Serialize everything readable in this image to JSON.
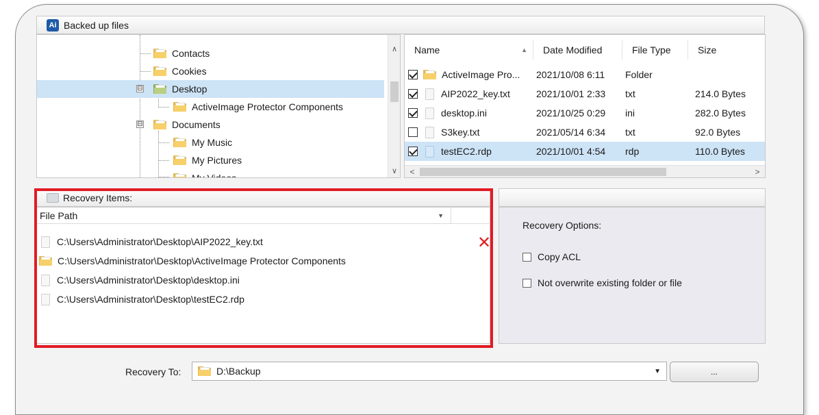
{
  "backed_up": {
    "title": "Backed up files",
    "app_icon_text": "Ai"
  },
  "tree": {
    "items": [
      {
        "label": "Contacts"
      },
      {
        "label": "Cookies"
      },
      {
        "label": "Desktop",
        "expander": "⊟"
      },
      {
        "label": "ActiveImage Protector Components"
      },
      {
        "label": "Documents",
        "expander": "⊟"
      },
      {
        "label": "My Music"
      },
      {
        "label": "My Pictures"
      },
      {
        "label": "My Videos"
      }
    ]
  },
  "file_list": {
    "columns": {
      "name": "Name",
      "date": "Date Modified",
      "type": "File Type",
      "size": "Size"
    },
    "rows": [
      {
        "name": "ActiveImage Pro...",
        "date": "2021/10/08 6:11",
        "type": "Folder",
        "size": "",
        "checked": true
      },
      {
        "name": "AIP2022_key.txt",
        "date": "2021/10/01 2:33",
        "type": "txt",
        "size": "214.0 Bytes",
        "checked": true
      },
      {
        "name": "desktop.ini",
        "date": "2021/10/25 0:29",
        "type": "ini",
        "size": "282.0 Bytes",
        "checked": true
      },
      {
        "name": "S3key.txt",
        "date": "2021/05/14 6:34",
        "type": "txt",
        "size": "92.0 Bytes",
        "checked": false
      },
      {
        "name": "testEC2.rdp",
        "date": "2021/10/01 4:54",
        "type": "rdp",
        "size": "110.0 Bytes",
        "checked": true
      }
    ]
  },
  "recovery_items": {
    "title": "Recovery Items:",
    "column": "File Path",
    "rows": [
      {
        "path": "C:\\Users\\Administrator\\Desktop\\AIP2022_key.txt",
        "icon": "file-icon"
      },
      {
        "path": "C:\\Users\\Administrator\\Desktop\\ActiveImage Protector Components",
        "icon": "folder-icon"
      },
      {
        "path": "C:\\Users\\Administrator\\Desktop\\desktop.ini",
        "icon": "file-icon"
      },
      {
        "path": "C:\\Users\\Administrator\\Desktop\\testEC2.rdp",
        "icon": "file-icon"
      }
    ]
  },
  "options": {
    "title": "Recovery Options:",
    "copy_acl": "Copy ACL",
    "not_overwrite": "Not overwrite existing folder or file"
  },
  "recovery_to": {
    "label": "Recovery To:",
    "value": "D:\\Backup",
    "browse_label": "..."
  },
  "colors": {
    "highlight_frame": "#e21b24",
    "selection": "#cde3f6",
    "remove_icon": "#e02020"
  }
}
